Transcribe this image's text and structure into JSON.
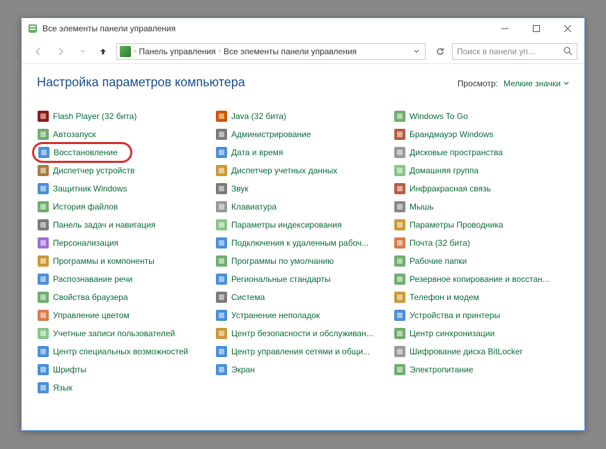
{
  "window": {
    "title": "Все элементы панели управления"
  },
  "breadcrumb": {
    "seg1": "Панель управления",
    "seg2": "Все элементы панели управления"
  },
  "search": {
    "placeholder": "Поиск в панели уп..."
  },
  "page": {
    "title": "Настройка параметров компьютера",
    "view_label": "Просмотр:",
    "view_value": "Мелкие значки"
  },
  "items": {
    "c0": [
      "Flash Player (32 бита)",
      "Автозапуск",
      "Восстановление",
      "Диспетчер устройств",
      "Защитник Windows",
      "История файлов",
      "Панель задач и навигация",
      "Персонализация",
      "Программы и компоненты",
      "Распознавание речи",
      "Свойства браузера",
      "Управление цветом",
      "Учетные записи пользователей",
      "Центр специальных возможностей",
      "Шрифты",
      "Язык"
    ],
    "c1": [
      "Java (32 бита)",
      "Администрирование",
      "Дата и время",
      "Диспетчер учетных данных",
      "Звук",
      "Клавиатура",
      "Параметры индексирования",
      "Подключения к удаленным рабоч...",
      "Программы по умолчанию",
      "Региональные стандарты",
      "Система",
      "Устранение неполадок",
      "Центр безопасности и обслуживан...",
      "Центр управления сетями и общи...",
      "Экран"
    ],
    "c2": [
      "Windows To Go",
      "Брандмауэр Windows",
      "Дисковые пространства",
      "Домашняя группа",
      "Инфракрасная связь",
      "Мышь",
      "Параметры Проводника",
      "Почта (32 бита)",
      "Рабочие папки",
      "Резервное копирование и восстан...",
      "Телефон и модем",
      "Устройства и принтеры",
      "Центр синхронизации",
      "Шифрование диска BitLocker",
      "Электропитание"
    ]
  },
  "icons": {
    "c0": [
      "#8b1a1a",
      "#6fae6f",
      "#4a8fd8",
      "#a87b3f",
      "#4a8fd8",
      "#6fae6f",
      "#7a7a7a",
      "#9b6fd8",
      "#cc9933",
      "#4a8fd8",
      "#6fae6f",
      "#d87b4a",
      "#87c687",
      "#4a8fd8",
      "#4a8fd8",
      "#4a8fd8"
    ],
    "c1": [
      "#cc5500",
      "#7a7a7a",
      "#4a8fd8",
      "#cc9933",
      "#7a7a7a",
      "#999",
      "#87c687",
      "#4a8fd8",
      "#6fae6f",
      "#4a8fd8",
      "#7a7a7a",
      "#4a8fd8",
      "#cc9933",
      "#4a8fd8",
      "#4a8fd8"
    ],
    "c2": [
      "#6fae6f",
      "#b85c3e",
      "#999",
      "#87c687",
      "#b85c3e",
      "#888",
      "#cc9933",
      "#d87b4a",
      "#6fae6f",
      "#6fae6f",
      "#cc9933",
      "#4a8fd8",
      "#6fae6f",
      "#999",
      "#6fae6f"
    ]
  },
  "highlighted": {
    "col": 0,
    "row": 2
  }
}
